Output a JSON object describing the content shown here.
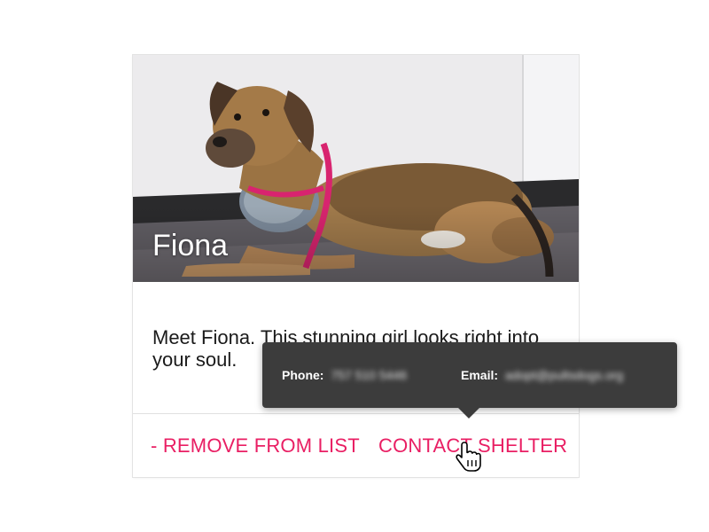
{
  "card": {
    "pet_name": "Fiona",
    "description": "Meet Fiona. This stunning girl looks right into your soul.",
    "actions": {
      "remove_label": "- REMOVE FROM LIST",
      "contact_label": "CONTACT SHELTER"
    }
  },
  "tooltip": {
    "phone_label": "Phone:",
    "phone_value": "757 510 5446",
    "email_label": "Email:",
    "email_value": "adopt@pultsdogs.org"
  },
  "colors": {
    "accent": "#e91e63",
    "tooltip_bg": "#3c3c3c"
  },
  "icons": {
    "cursor": "hand-pointer-icon"
  }
}
